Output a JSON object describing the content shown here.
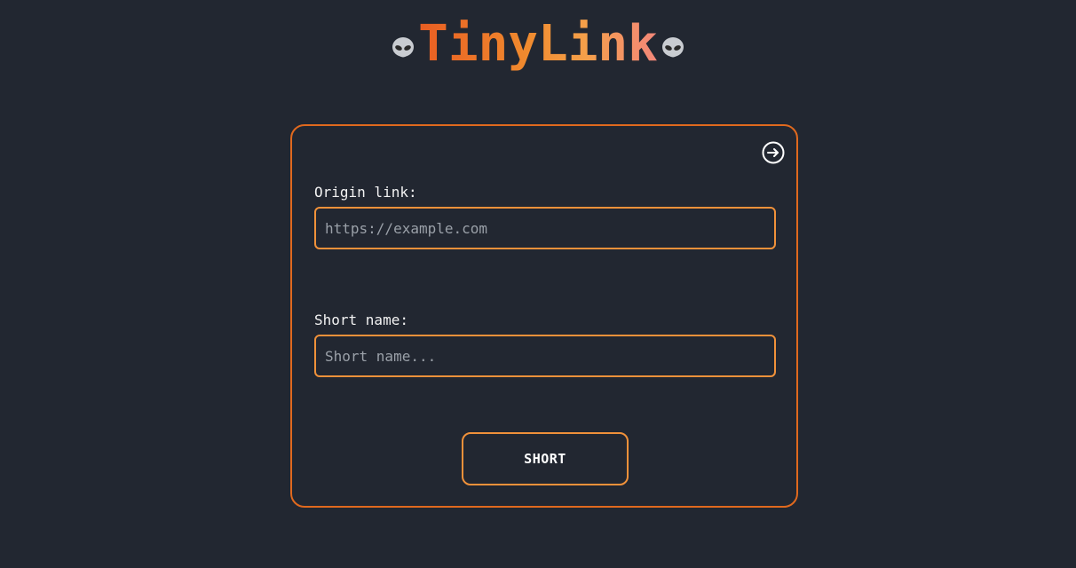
{
  "header": {
    "title": "TinyLink",
    "left_icon": "alien-icon",
    "right_icon": "alien-icon"
  },
  "card": {
    "nav_icon": "arrow-right-circle-icon",
    "origin": {
      "label": "Origin link:",
      "placeholder": "https://example.com",
      "value": ""
    },
    "short_name": {
      "label": "Short name:",
      "placeholder": "Short name...",
      "value": ""
    },
    "submit_label": "SHORT"
  },
  "colors": {
    "background": "#222731",
    "accent": "#e0691e",
    "input_border": "#f0913a",
    "title_gradient_start": "#e85d22",
    "title_gradient_end": "#f3877a"
  }
}
